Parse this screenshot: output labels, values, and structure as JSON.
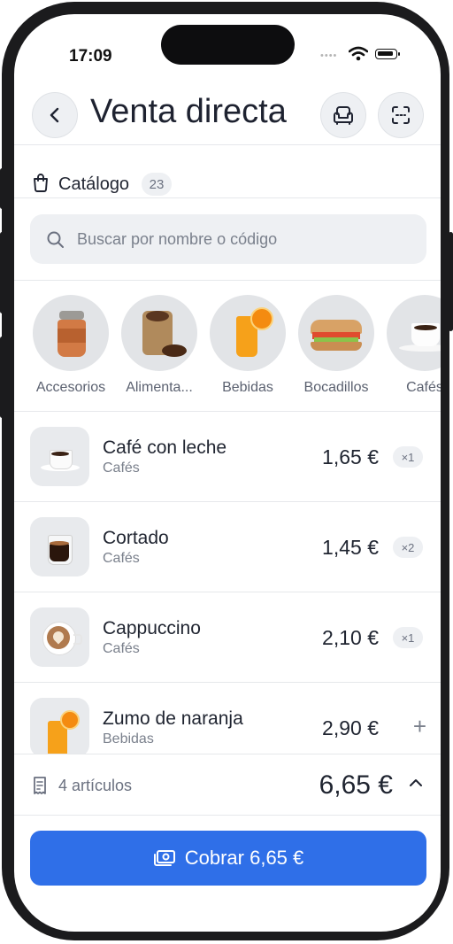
{
  "status_bar": {
    "time": "17:09",
    "signal": "••••"
  },
  "header": {
    "title": "Venta directa",
    "back_icon": "chevron-left-icon",
    "sofa_icon": "armchair-icon",
    "scan_icon": "scan-icon"
  },
  "catalog": {
    "label": "Catálogo",
    "count": "23",
    "icon": "shopping-bag-icon"
  },
  "search": {
    "placeholder": "Buscar por nombre o código",
    "icon": "search-icon"
  },
  "categories": [
    {
      "label": "Accesorios"
    },
    {
      "label": "Alimenta..."
    },
    {
      "label": "Bebidas"
    },
    {
      "label": "Bocadillos"
    },
    {
      "label": "Cafés"
    }
  ],
  "products": [
    {
      "name": "Café con leche",
      "category": "Cafés",
      "price": "1,65 €",
      "qty": "×1"
    },
    {
      "name": "Cortado",
      "category": "Cafés",
      "price": "1,45 €",
      "qty": "×2"
    },
    {
      "name": "Cappuccino",
      "category": "Cafés",
      "price": "2,10 €",
      "qty": "×1"
    },
    {
      "name": "Zumo de naranja",
      "category": "Bebidas",
      "price": "2,90 €",
      "qty": "+"
    }
  ],
  "summary": {
    "items": "4 artículos",
    "total": "6,65 €"
  },
  "pay_button": {
    "label": "Cobrar 6,65 €"
  },
  "colors": {
    "accent": "#2f6fe8",
    "surface": "#eef0f3"
  }
}
